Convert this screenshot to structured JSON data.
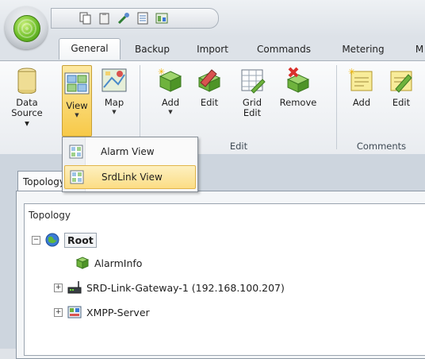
{
  "tabs": [
    "General",
    "Backup",
    "Import",
    "Commands",
    "Metering",
    "M"
  ],
  "ribbon": {
    "buttons": {
      "data_source": [
        "Data",
        "Source ▾"
      ],
      "view": "View",
      "map": "Map",
      "add": "Add",
      "edit": "Edit",
      "grid_edit": [
        "Grid",
        "Edit"
      ],
      "remove": "Remove",
      "comment_add": "Add",
      "comment_edit": "Edit"
    },
    "groups": {
      "edit": "Edit",
      "comments": "Comments"
    }
  },
  "dropdown": {
    "items": [
      {
        "label": "Alarm View",
        "icon": "view-grid-icon"
      },
      {
        "label": "SrdLink View",
        "icon": "view-grid-icon",
        "highlighted": true
      }
    ]
  },
  "panel": {
    "tab_label": "Topology",
    "header": "Topology",
    "tree": {
      "root": "Root",
      "children": [
        {
          "label": "AlarmInfo",
          "icon": "cube-icon"
        },
        {
          "label": "SRD-Link-Gateway-1 (192.168.100.207)",
          "icon": "gateway-icon"
        },
        {
          "label": "XMPP-Server",
          "icon": "server-icon"
        }
      ]
    }
  },
  "colors": {
    "accent": "#f7c948",
    "selection": "#fcdd85",
    "chrome": "#dde2e8"
  }
}
